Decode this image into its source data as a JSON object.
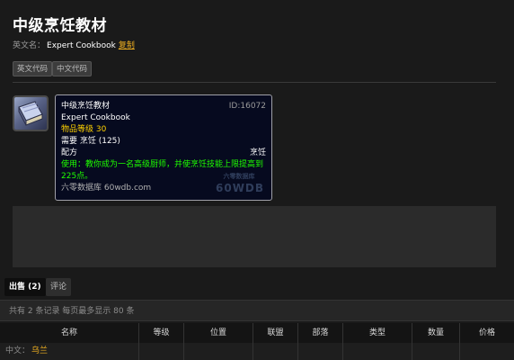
{
  "page": {
    "title": "中级烹饪教材",
    "subtitle_label": "英文名：",
    "en_name": "Expert Cookbook",
    "copy_label": "复制"
  },
  "code_buttons": [
    "英文代码",
    "中文代码"
  ],
  "item_icon": "book-icon",
  "tooltip": {
    "name": "中级烹饪教材",
    "id": "ID:16072",
    "en_name": "Expert Cookbook",
    "item_level": "物品等级 30",
    "requires": "需要 烹饪 (125)",
    "type_left": "配方",
    "type_right": "烹饪",
    "use": "使用：教你成为一名高级厨师，并使烹饪技能上限提高到225点。",
    "site": "六零数据库 60wdb.com",
    "watermark_cn": "六零数据库",
    "watermark_en": "60WDB"
  },
  "tabs": {
    "sale": "出售 (2)",
    "comment": "评论"
  },
  "record_summary": "共有 2 条记录 每页最多显示 80 条",
  "table": {
    "headers": [
      "名称",
      "等级",
      "位置",
      "联盟",
      "部落",
      "类型",
      "数量",
      "价格"
    ],
    "rows": [
      {
        "name_label": "中文：",
        "name": "乌兰"
      }
    ]
  },
  "colors": {
    "background": "#1a1a1a",
    "accent_gold": "#f0b020",
    "use_green": "#1eff00",
    "level_yellow": "#ffd100",
    "tooltip_bg": "#060a1f"
  }
}
